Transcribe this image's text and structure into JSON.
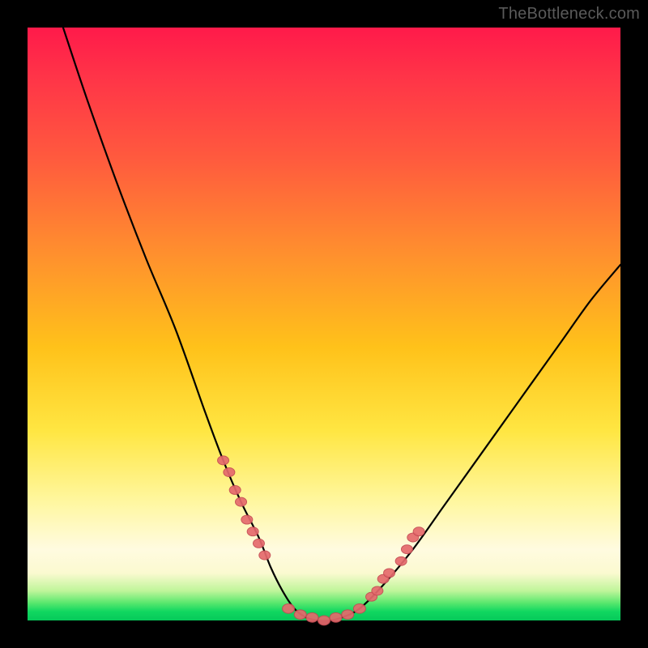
{
  "watermark": "TheBottleneck.com",
  "colors": {
    "frame": "#000000",
    "gradient_top": "#ff1a4a",
    "gradient_mid1": "#ff8f2e",
    "gradient_mid2": "#ffe642",
    "gradient_bottom_cream": "#fffbe0",
    "gradient_green": "#06c95a",
    "curve": "#000000",
    "marker_fill": "#e66a6d",
    "marker_stroke": "#c44a52"
  },
  "chart_data": {
    "type": "line",
    "title": "",
    "xlabel": "",
    "ylabel": "",
    "xlim": [
      0,
      100
    ],
    "ylim": [
      0,
      100
    ],
    "grid": false,
    "legend": false,
    "series": [
      {
        "name": "bottleneck-curve",
        "x": [
          6,
          10,
          15,
          20,
          25,
          30,
          33,
          36,
          39,
          41,
          43,
          45,
          47,
          49,
          51,
          53,
          56,
          60,
          65,
          70,
          75,
          80,
          85,
          90,
          95,
          100
        ],
        "y": [
          100,
          88,
          74,
          61,
          49,
          35,
          27,
          20,
          14,
          9,
          5,
          2,
          0.5,
          0,
          0,
          0.5,
          2,
          6,
          12,
          19,
          26,
          33,
          40,
          47,
          54,
          60
        ]
      }
    ],
    "markers": {
      "name": "highlighted-points",
      "left_cluster": [
        [
          33,
          27
        ],
        [
          34,
          25
        ],
        [
          35,
          22
        ],
        [
          36,
          20
        ],
        [
          37,
          17
        ],
        [
          38,
          15
        ],
        [
          39,
          13
        ],
        [
          40,
          11
        ]
      ],
      "bottom_cluster": [
        [
          44,
          2
        ],
        [
          46,
          1
        ],
        [
          48,
          0.5
        ],
        [
          50,
          0
        ],
        [
          52,
          0.5
        ],
        [
          54,
          1
        ],
        [
          56,
          2
        ]
      ],
      "right_cluster": [
        [
          58,
          4
        ],
        [
          59,
          5
        ],
        [
          60,
          7
        ],
        [
          61,
          8
        ],
        [
          63,
          10
        ],
        [
          64,
          12
        ],
        [
          65,
          14
        ],
        [
          66,
          15
        ]
      ]
    }
  }
}
